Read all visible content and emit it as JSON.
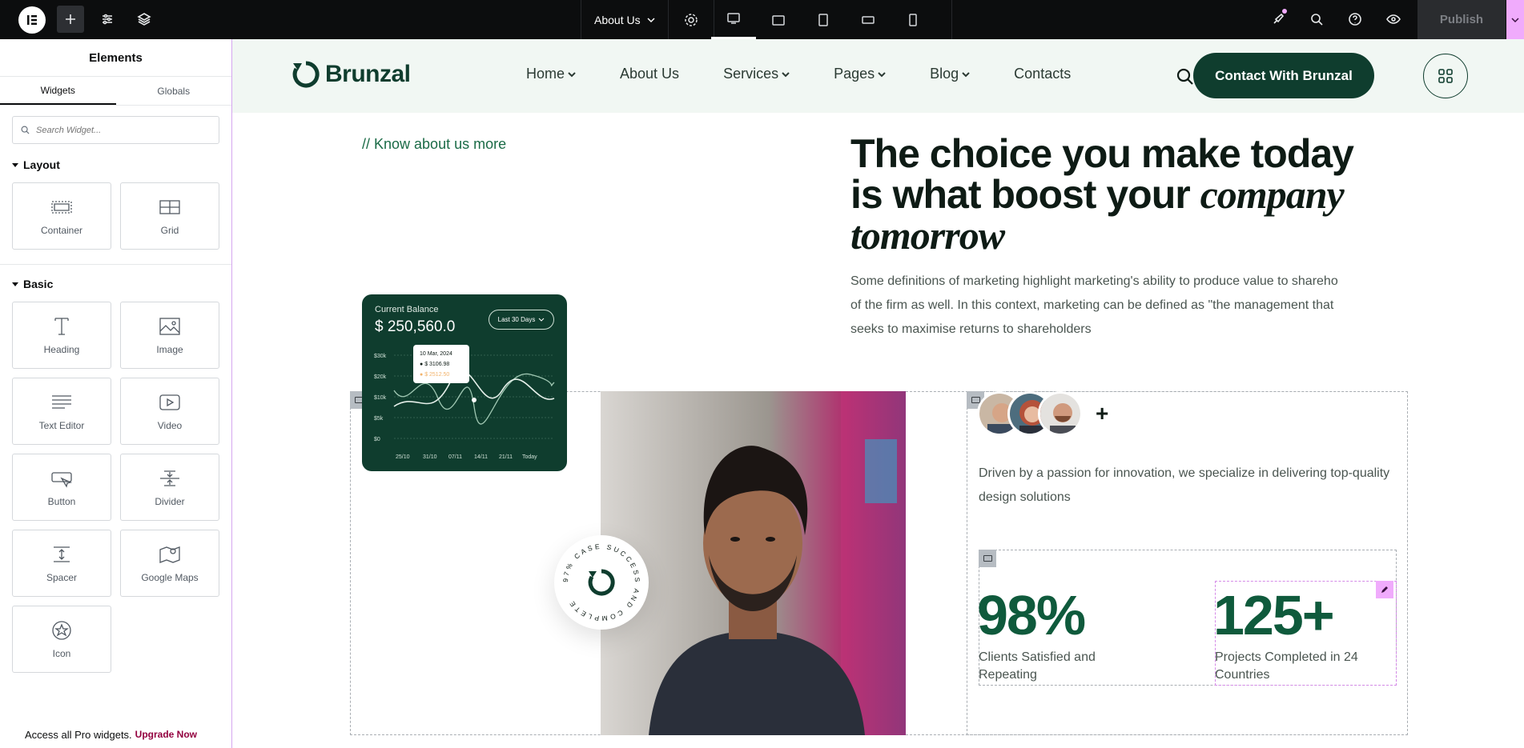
{
  "editor": {
    "page_name": "About Us",
    "publish_label": "Publish",
    "panel_title": "Elements",
    "tabs": [
      "Widgets",
      "Globals"
    ],
    "search_placeholder": "Search Widget...",
    "sections": {
      "layout": {
        "title": "Layout",
        "widgets": [
          "Container",
          "Grid"
        ]
      },
      "basic": {
        "title": "Basic",
        "widgets": [
          "Heading",
          "Image",
          "Text Editor",
          "Video",
          "Button",
          "Divider",
          "Spacer",
          "Google Maps",
          "Icon"
        ]
      }
    },
    "pro_text": "Access all Pro widgets.",
    "pro_link": "Upgrade Now",
    "accent": "#f0abfc"
  },
  "site": {
    "brand": "Brunzal",
    "nav": [
      "Home",
      "About Us",
      "Services",
      "Pages",
      "Blog",
      "Contacts"
    ],
    "cta": "Contact With Brunzal",
    "eyebrow": "// Know about us more",
    "headline_plain": "The choice you make today is what boost your",
    "headline_italic": "company tomorrow",
    "paragraph": "Some definitions of marketing highlight marketing's ability to produce value to shareho of the firm as well. In this context, marketing can be defined as \"the management that seeks to maximise returns to shareholders",
    "card": {
      "title": "Current Balance",
      "amount": "$ 250,560.0",
      "range": "Last 30 Days",
      "tip_date": "10 Mar, 2024",
      "tip_v1": "$ 3106.98",
      "tip_v2": "$ 2512.50",
      "y_ticks": [
        "$30k",
        "$20k",
        "$10k",
        "$5k",
        "$0"
      ],
      "x_ticks": [
        "25/10",
        "31/10",
        "07/11",
        "14/11",
        "21/11",
        "Today"
      ]
    },
    "badge_text": "97% CASE SUCCESS AND COMPLETE",
    "driven": "Driven by a passion for innovation, we specialize in delivering top-quality design solutions",
    "stats": [
      {
        "value": "98%",
        "label": "Clients Satisfied and Repeating"
      },
      {
        "value": "125+",
        "label": "Projects Completed in 24 Countries"
      }
    ],
    "brand_color": "#0f3d2e"
  }
}
